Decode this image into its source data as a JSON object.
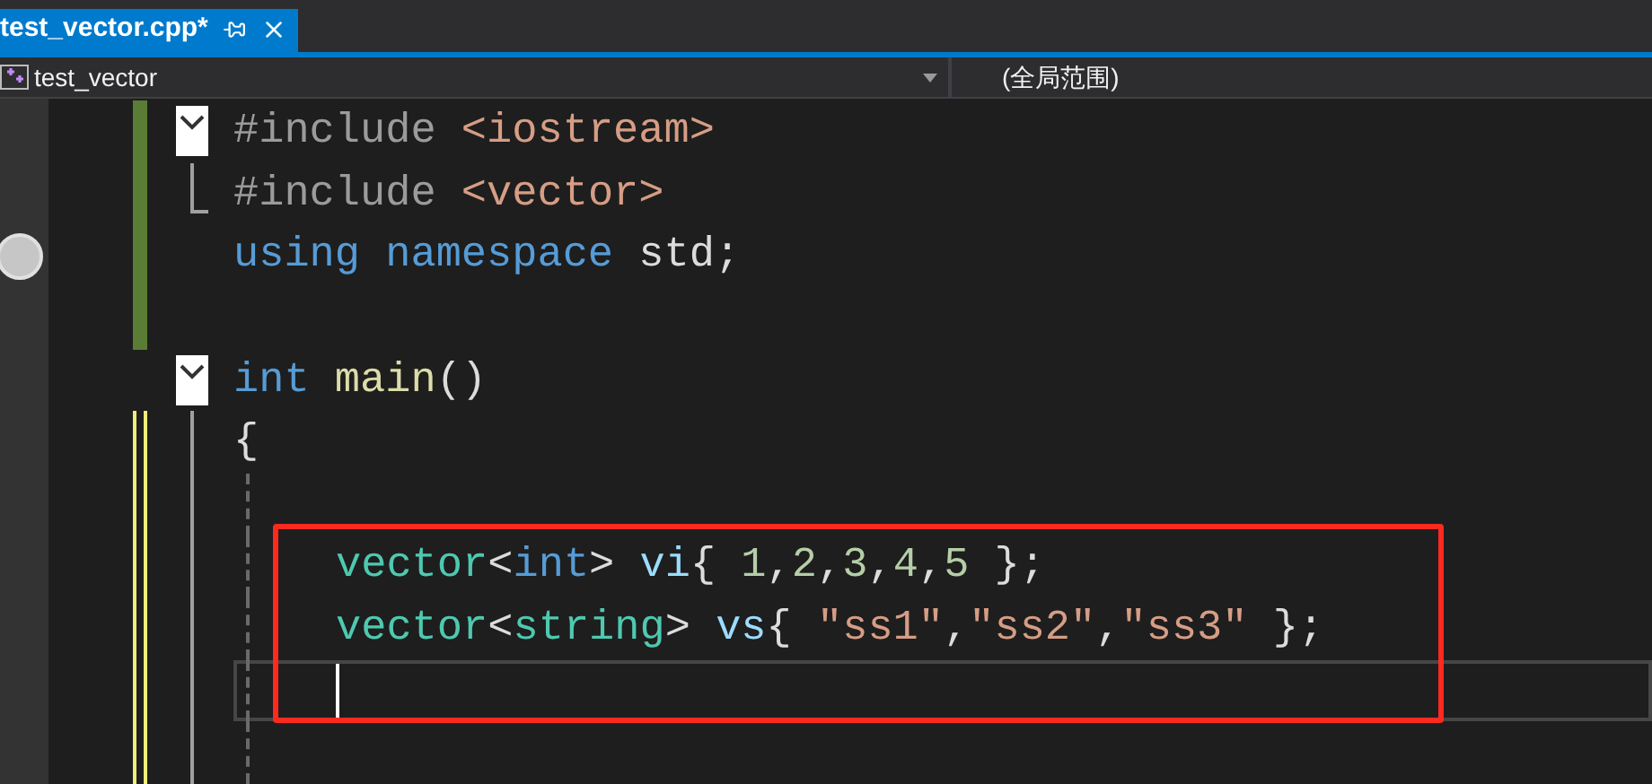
{
  "tab": {
    "title": "test_vector.cpp*",
    "selected": true
  },
  "nav_bar": {
    "project": "test_vector",
    "scope": "(全局范围)"
  },
  "lines": [
    {
      "collapsible": true,
      "fold_guide": false,
      "fold_end": false,
      "saved_change": true,
      "unsaved_change": false,
      "breakpoint": false,
      "current": false,
      "tokens": [
        {
          "kind": "preproc",
          "text": "#include"
        },
        {
          "kind": "path",
          "text": " <iostream>"
        }
      ]
    },
    {
      "collapsible": false,
      "fold_guide": false,
      "fold_end": true,
      "saved_change": true,
      "unsaved_change": false,
      "breakpoint": false,
      "current": false,
      "tokens": [
        {
          "kind": "preproc",
          "text": "#include"
        },
        {
          "kind": "path",
          "text": " <vector>"
        }
      ]
    },
    {
      "collapsible": false,
      "fold_guide": false,
      "fold_end": false,
      "saved_change": true,
      "unsaved_change": false,
      "breakpoint": true,
      "current": false,
      "tokens": [
        {
          "kind": "keyword",
          "text": "using"
        },
        {
          "kind": "keyword",
          "text": " namespace"
        },
        {
          "kind": "plain",
          "text": " std;"
        }
      ]
    },
    {
      "collapsible": false,
      "fold_guide": false,
      "fold_end": false,
      "saved_change": true,
      "unsaved_change": false,
      "breakpoint": false,
      "current": false
    },
    {
      "collapsible": true,
      "fold_guide": false,
      "fold_end": false,
      "saved_change": false,
      "unsaved_change": false,
      "breakpoint": false,
      "current": false,
      "tokens": [
        {
          "kind": "keyword",
          "text": "int"
        },
        {
          "kind": "function",
          "text": " main"
        },
        {
          "kind": "plain",
          "text": "()"
        }
      ]
    },
    {
      "collapsible": false,
      "fold_guide": true,
      "fold_end": false,
      "saved_change": false,
      "unsaved_change": true,
      "breakpoint": false,
      "current": false,
      "tokens": [
        {
          "kind": "plain",
          "text": "{"
        }
      ],
      "children": [
        {
          "collapsible": false,
          "fold_guide": true,
          "fold_end": false,
          "saved_change": false,
          "unsaved_change": true,
          "breakpoint": false,
          "current": false
        },
        {
          "collapsible": false,
          "fold_guide": true,
          "fold_end": false,
          "saved_change": false,
          "unsaved_change": true,
          "breakpoint": false,
          "current": false,
          "tokens": [
            {
              "kind": "type",
              "text": "vector"
            },
            {
              "kind": "plain",
              "text": "<"
            },
            {
              "kind": "keyword",
              "text": "int"
            },
            {
              "kind": "plain",
              "text": ">"
            },
            {
              "kind": "variable",
              "text": " vi"
            },
            {
              "kind": "plain",
              "text": "{"
            },
            {
              "kind": "number",
              "text": " 1"
            },
            {
              "kind": "plain",
              "text": ","
            },
            {
              "kind": "number",
              "text": "2"
            },
            {
              "kind": "plain",
              "text": ","
            },
            {
              "kind": "number",
              "text": "3"
            },
            {
              "kind": "plain",
              "text": ","
            },
            {
              "kind": "number",
              "text": "4"
            },
            {
              "kind": "plain",
              "text": ","
            },
            {
              "kind": "number",
              "text": "5"
            },
            {
              "kind": "plain",
              "text": " };"
            }
          ]
        },
        {
          "collapsible": false,
          "fold_guide": true,
          "fold_end": false,
          "saved_change": false,
          "unsaved_change": true,
          "breakpoint": false,
          "current": false,
          "tokens": [
            {
              "kind": "type",
              "text": "vector"
            },
            {
              "kind": "plain",
              "text": "<"
            },
            {
              "kind": "type",
              "text": "string"
            },
            {
              "kind": "plain",
              "text": ">"
            },
            {
              "kind": "variable",
              "text": " vs"
            },
            {
              "kind": "plain",
              "text": "{"
            },
            {
              "kind": "string",
              "text": " \"ss1\""
            },
            {
              "kind": "plain",
              "text": ","
            },
            {
              "kind": "string",
              "text": "\"ss2\""
            },
            {
              "kind": "plain",
              "text": ","
            },
            {
              "kind": "string",
              "text": "\"ss3\""
            },
            {
              "kind": "plain",
              "text": " };"
            }
          ]
        },
        {
          "collapsible": false,
          "fold_guide": true,
          "fold_end": false,
          "saved_change": false,
          "unsaved_change": true,
          "breakpoint": false,
          "current": true
        },
        {
          "collapsible": false,
          "fold_guide": true,
          "fold_end": false,
          "saved_change": false,
          "unsaved_change": true,
          "breakpoint": false,
          "current": false
        }
      ]
    }
  ]
}
